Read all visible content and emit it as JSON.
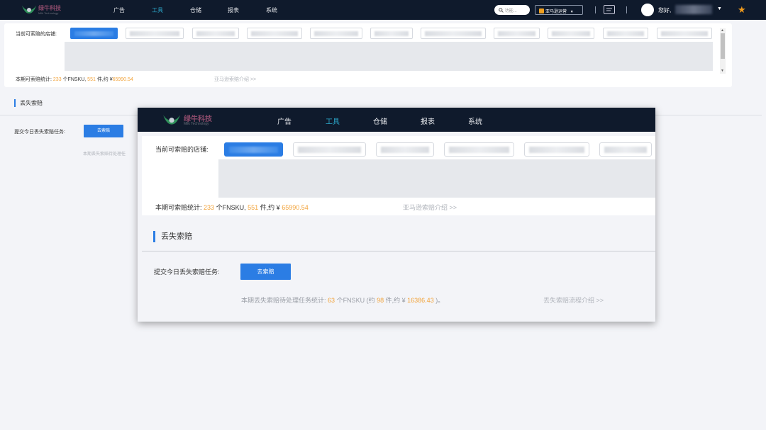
{
  "header": {
    "logo_name": "绿牛科技",
    "logo_sub": "Milk Technology",
    "nav": [
      {
        "label": "广告"
      },
      {
        "label": "工具"
      },
      {
        "label": "仓储"
      },
      {
        "label": "报表"
      },
      {
        "label": "系统"
      }
    ],
    "search_placeholder": "功能...",
    "site_select": "亚马逊运营",
    "greeting": "您好,",
    "caret": "▼",
    "star": "★"
  },
  "stores": {
    "label": "当前可索赔的店铺:",
    "stats_prefix": "本期可索赔统计:",
    "sku_count": "233",
    "sku_unit": "个FNSKU,",
    "item_count": "551",
    "item_unit": "件,约 ¥",
    "amount": "65990.54",
    "intro_link": "亚马逊索赔介绍 >>"
  },
  "lost": {
    "title": "丢失索赔",
    "task_label": "提交今日丢失索赔任务:",
    "button": "去索赔",
    "faded_text": "本期丢失索赔待处理任",
    "pending_prefix": "本期丢失索赔待处理任务统计:",
    "pending_sku": "63",
    "pending_sku_unit": "个FNSKU (约",
    "pending_items": "98",
    "pending_items_unit": "件,约 ¥",
    "pending_amount": "16386.43",
    "pending_suffix": ")。",
    "flow_link": "丢失索赔流程介绍 >>"
  }
}
